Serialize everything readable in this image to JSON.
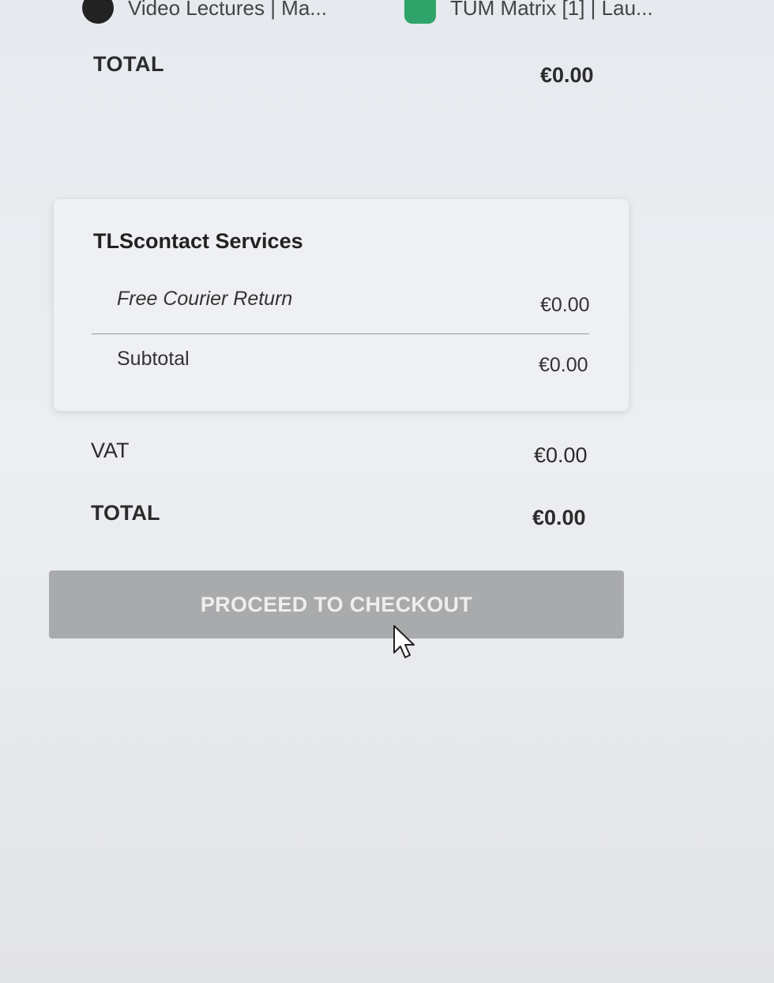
{
  "bookmarks_bar": {
    "items": [
      {
        "label": "Video Lectures | Ma...",
        "icon": "lecture-site-icon"
      },
      {
        "label": "TUM Matrix [1] | Lau...",
        "icon": "matrix-chat-icon"
      }
    ]
  },
  "summary_top": {
    "total_label": "TOTAL",
    "total_value": "€0.00"
  },
  "services_card": {
    "title": "TLScontact Services",
    "items": [
      {
        "label": "Free Courier Return",
        "value": "€0.00"
      }
    ],
    "subtotal_label": "Subtotal",
    "subtotal_value": "€0.00"
  },
  "summary": {
    "vat_label": "VAT",
    "vat_value": "€0.00",
    "total_label": "TOTAL",
    "total_value": "€0.00"
  },
  "checkout": {
    "button_label": "PROCEED TO CHECKOUT",
    "enabled": false
  },
  "colors": {
    "button_disabled": "#a9aaab",
    "card_background": "#eff0f3",
    "page_background": "#e8eaee"
  }
}
